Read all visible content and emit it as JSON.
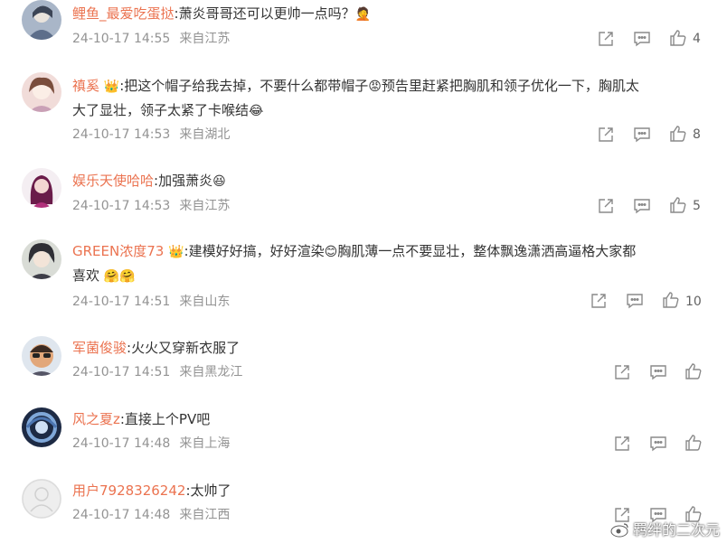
{
  "comments": [
    {
      "user": "鲤鱼_最爱吃蛋挞",
      "text": ":萧炎哥哥还可以更帅一点吗？",
      "time": "24-10-17 14:55",
      "location": "来自江苏",
      "likes": "4"
    },
    {
      "user": "禛奚",
      "text_a": ":把这个帽子给我去掉，不要什么都带帽子",
      "text_b": "预告里赶紧把胸肌和领子优化一下，胸肌太",
      "text_c": "大了显壮，领子太紧了卡喉结",
      "time": "24-10-17 14:53",
      "location": "来自湖北",
      "likes": "8"
    },
    {
      "user": "娱乐天使哈哈",
      "text": ":加强萧炎",
      "time": "24-10-17 14:53",
      "location": "来自江苏",
      "likes": "5"
    },
    {
      "user": "GREEN浓度73",
      "text_a": ":建模好好搞，好好渲染",
      "text_b": "胸肌薄一点不要显壮，整体飘逸潇洒高逼格大家都",
      "text_c": "喜欢",
      "time": "24-10-17 14:51",
      "location": "来自山东",
      "likes": "10"
    },
    {
      "user": "军菌俊骏",
      "text": ":火火又穿新衣服了",
      "time": "24-10-17 14:51",
      "location": "来自黑龙江",
      "likes": ""
    },
    {
      "user": "风之夏z",
      "text": ":直接上个PV吧",
      "time": "24-10-17 14:48",
      "location": "来自上海",
      "likes": ""
    },
    {
      "user": "用户7928326242",
      "text": ":太帅了",
      "time": "24-10-17 14:48",
      "location": "来自江西",
      "likes": ""
    }
  ],
  "watermark": "羁绊的二次元",
  "colors": {
    "username": "#eb7350",
    "meta": "#939393",
    "text": "#333333"
  }
}
